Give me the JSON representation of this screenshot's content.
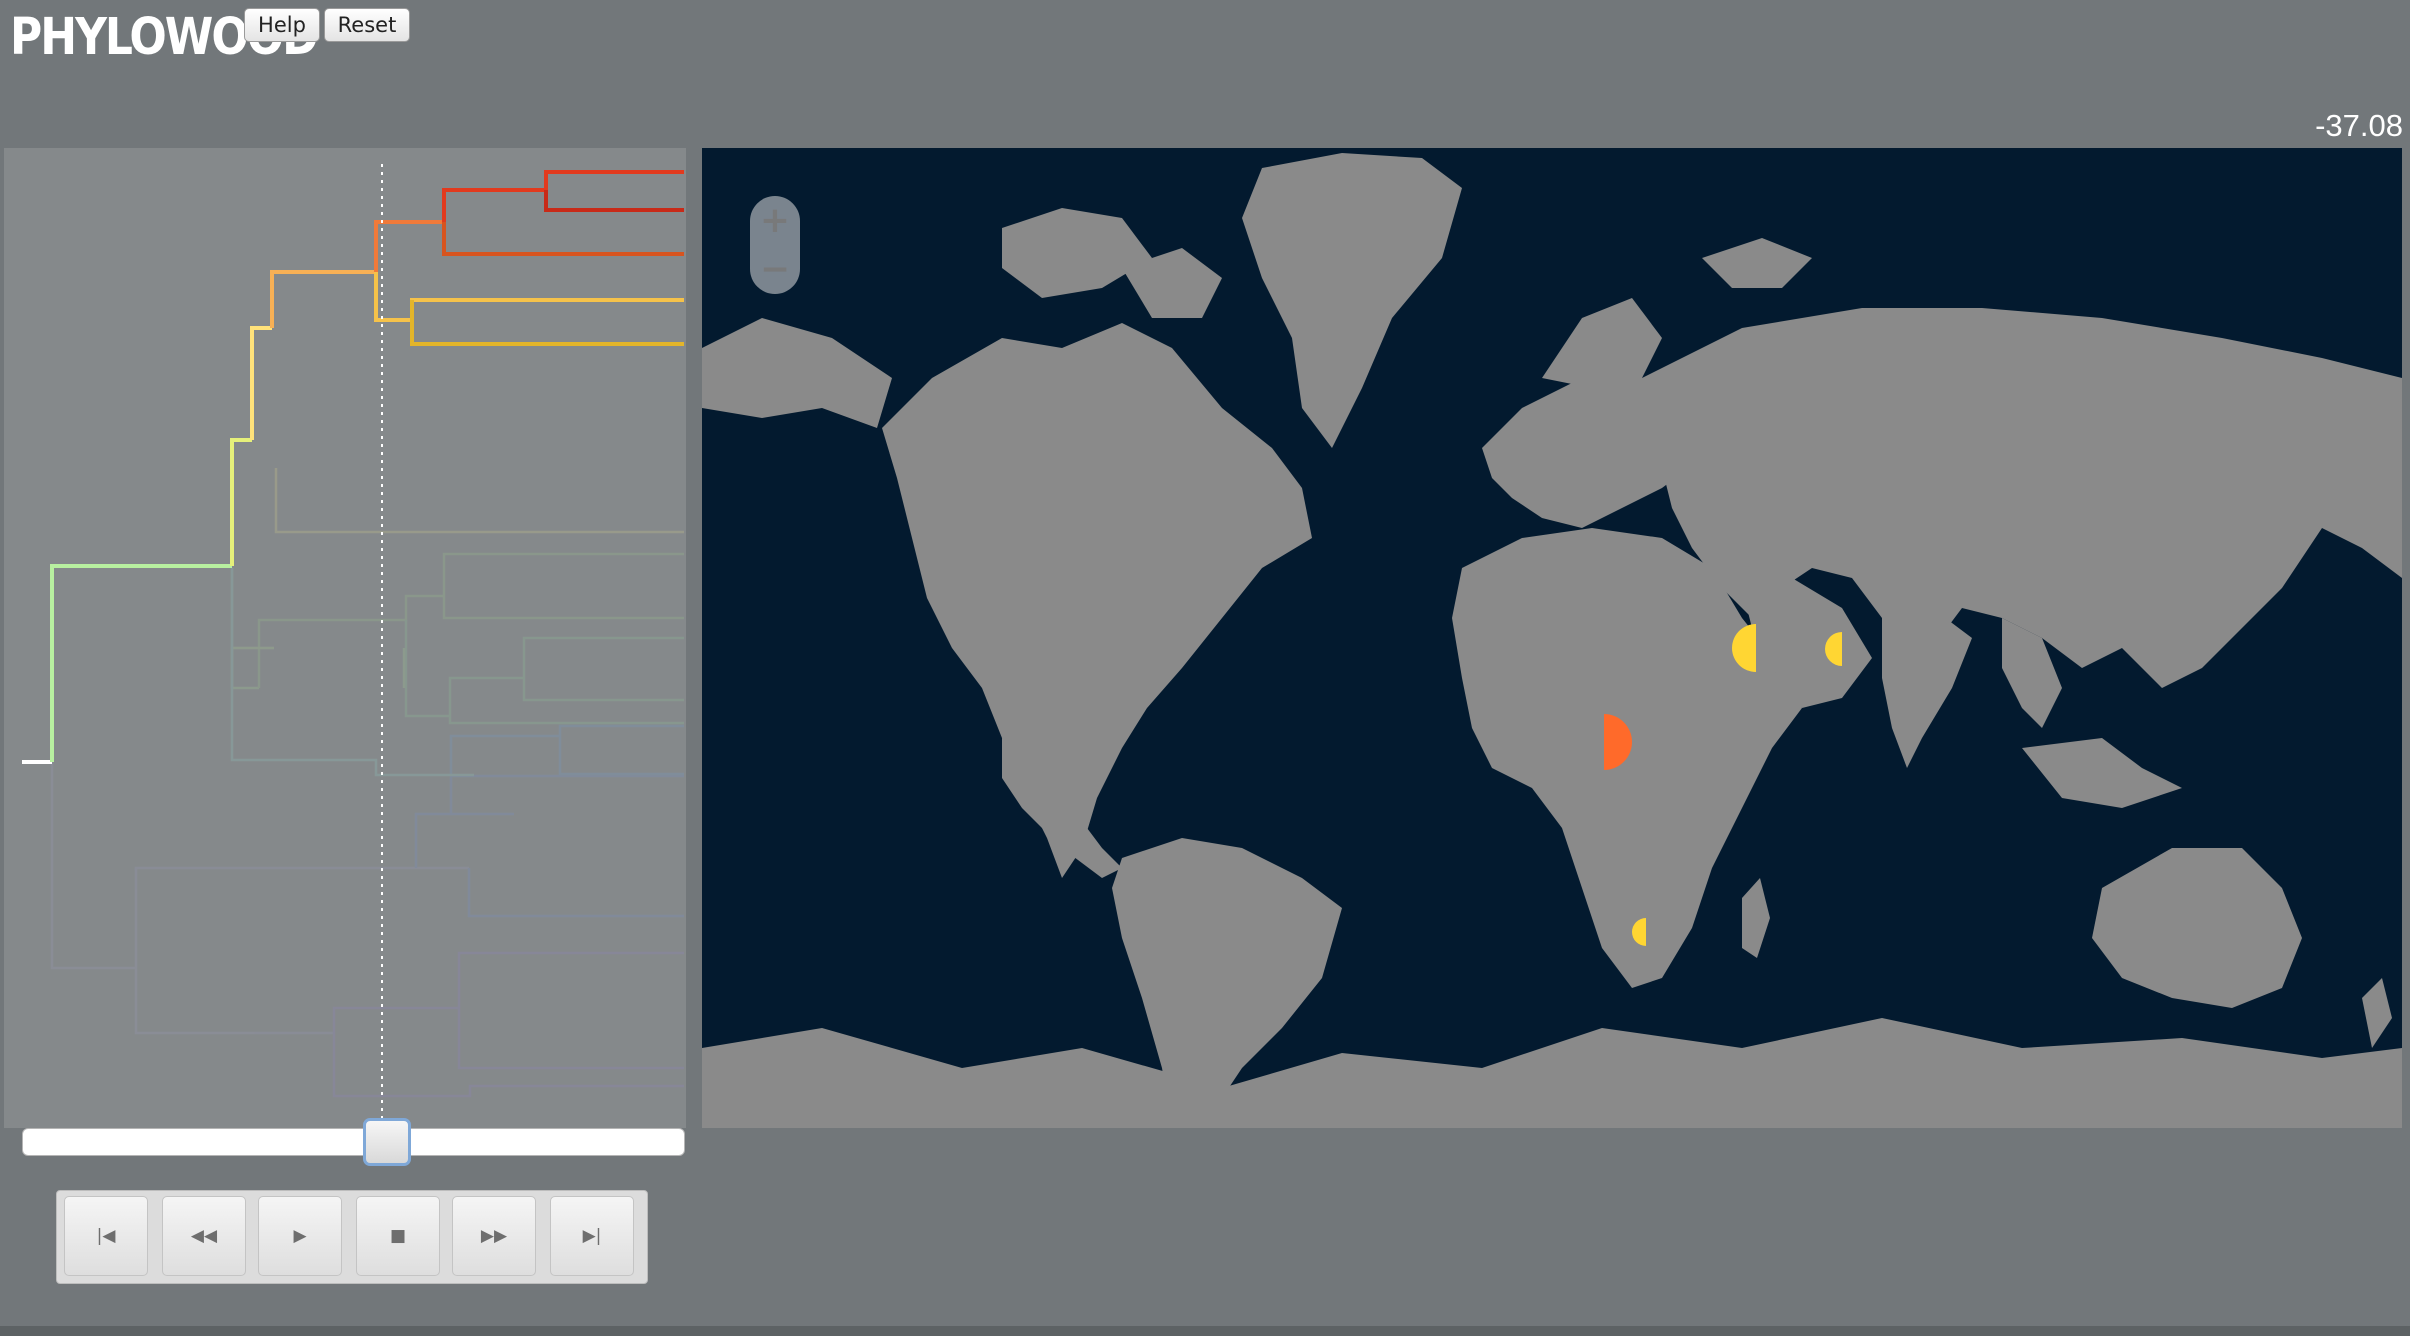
{
  "app": {
    "logo": "PHYLOWOOD",
    "help_label": "Help",
    "reset_label": "Reset",
    "time_readout": "-37.08"
  },
  "playback": {
    "slider_position": 0.55,
    "buttons": [
      {
        "name": "skip-to-start",
        "glyph": "|◀"
      },
      {
        "name": "rewind",
        "glyph": "◀◀"
      },
      {
        "name": "play",
        "glyph": "▶"
      },
      {
        "name": "stop",
        "glyph": "■"
      },
      {
        "name": "fast-forward",
        "glyph": "▶▶"
      },
      {
        "name": "skip-to-end",
        "glyph": "▶|"
      }
    ]
  },
  "map": {
    "zoom_in": "+",
    "zoom_out": "−",
    "markers": [
      {
        "name": "east-africa-marker",
        "color": "#ff6a2a",
        "side": "right"
      },
      {
        "name": "madagascar-marker",
        "color": "#ffd633",
        "side": "left"
      },
      {
        "name": "india-marker",
        "color": "#ffd633",
        "side": "left"
      },
      {
        "name": "indochina-marker",
        "color": "#ffd633",
        "side": "left"
      }
    ]
  },
  "colors": {
    "background": "#72777a",
    "panel": "#85898b",
    "ocean": "#031a2f",
    "land": "#8a8a8a",
    "accent_red": "#e23a1e",
    "accent_orange": "#f06a2c",
    "accent_yellow": "#ffd633"
  }
}
